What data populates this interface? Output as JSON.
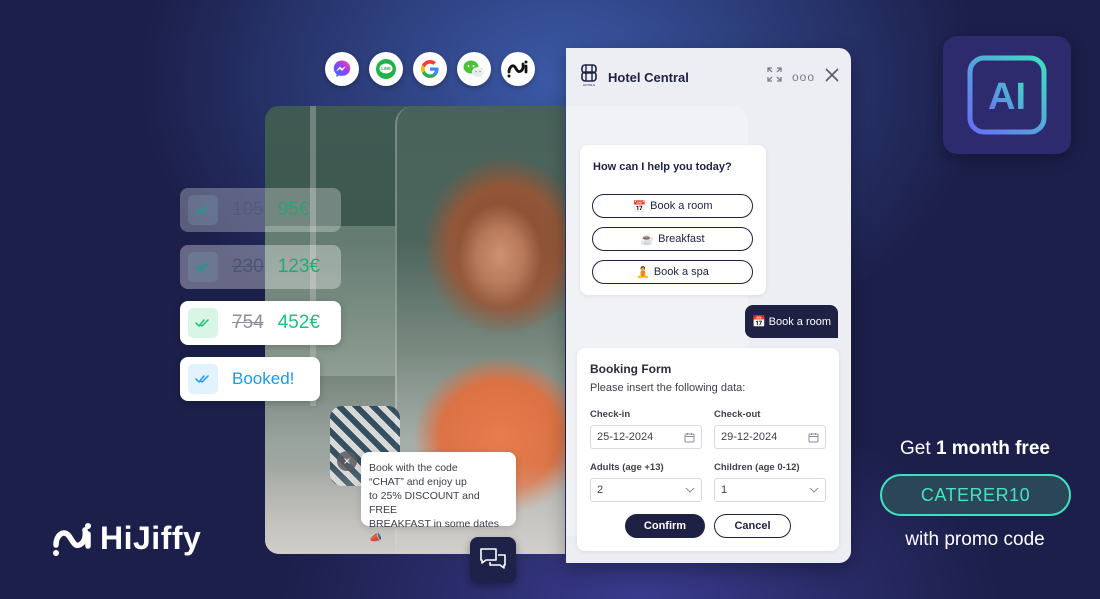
{
  "channels": [
    {
      "name": "messenger",
      "icon": "messenger-icon"
    },
    {
      "name": "line",
      "icon": "line-icon",
      "label": "LINE"
    },
    {
      "name": "google",
      "icon": "google-icon",
      "label": "G"
    },
    {
      "name": "wechat",
      "icon": "wechat-icon"
    },
    {
      "name": "hijiffy",
      "icon": "hijiffy-icon"
    }
  ],
  "price_cards": [
    {
      "old": "105",
      "new": "95€"
    },
    {
      "old": "230",
      "new": "123€"
    },
    {
      "old": "754",
      "new": "452€"
    }
  ],
  "booked_card": {
    "label": "Booked!"
  },
  "promo_bubble": {
    "close": "×",
    "lines": [
      "Book with the code",
      "“CHAT” and enjoy up",
      "to 25% DISCOUNT and FREE",
      "BREAKFAST in some dates📣"
    ]
  },
  "widget": {
    "title": "Hotel Central",
    "logo_caption": "HOTELS",
    "more_label": "ooo",
    "help": {
      "question": "How can I help you today?",
      "options": [
        {
          "emoji": "📅",
          "label": "Book a room"
        },
        {
          "emoji": "☕",
          "label": "Breakfast"
        },
        {
          "emoji": "🧘",
          "label": "Book a spa"
        }
      ]
    },
    "user_message": {
      "emoji": "📅",
      "text": "Book a room"
    },
    "form": {
      "title": "Booking Form",
      "subtitle": "Please insert the following data:",
      "checkin_label": "Check-in",
      "checkin_value": "25-12-2024",
      "checkout_label": "Check-out",
      "checkout_value": "29-12-2024",
      "adults_label": "Adults (age +13)",
      "adults_value": "2",
      "children_label": "Children (age 0-12)",
      "children_value": "1",
      "confirm": "Confirm",
      "cancel": "Cancel"
    }
  },
  "ai_badge": {
    "label": "AI"
  },
  "offer": {
    "prefix": "Get ",
    "highlight": "1 month free",
    "code": "CATERER10",
    "suffix": "with promo code"
  },
  "brand": {
    "name": "HiJiffy"
  },
  "colors": {
    "background": "#1c1f4a",
    "navy": "#1e2144",
    "green": "#1fc07a",
    "blue": "#1a9be4",
    "teal": "#3fe0c0"
  }
}
